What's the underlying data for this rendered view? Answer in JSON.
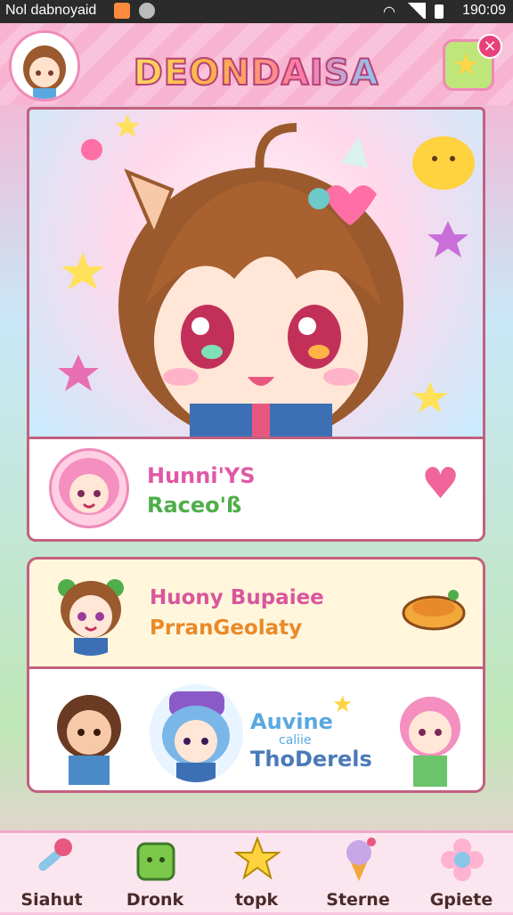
{
  "status_bar": {
    "left_text": "Nol dabnoyaid",
    "time": "190:09"
  },
  "header": {
    "title": "DEONDAISA"
  },
  "profile_card": {
    "line1": "Hunni'YS",
    "line2": "Raceo'ß"
  },
  "featured_card": {
    "line1": "Huony Bupaiee",
    "line2": "PrranGeolaty"
  },
  "characters_row": {
    "banner_text": "Auvine",
    "small_text": "caliie",
    "line2": "ThoDerels"
  },
  "bottom_nav": {
    "items": [
      {
        "label": "Siahut",
        "icon": "microphone-icon"
      },
      {
        "label": "Dronk",
        "icon": "green-cube-icon"
      },
      {
        "label": "topk",
        "icon": "star-trophy-icon"
      },
      {
        "label": "Sterne",
        "icon": "ice-cream-icon"
      },
      {
        "label": "Gpiete",
        "icon": "flower-icon"
      }
    ]
  },
  "colors": {
    "accent_pink": "#f08ab8",
    "border": "#c2607f",
    "heart": "#f0669a"
  }
}
